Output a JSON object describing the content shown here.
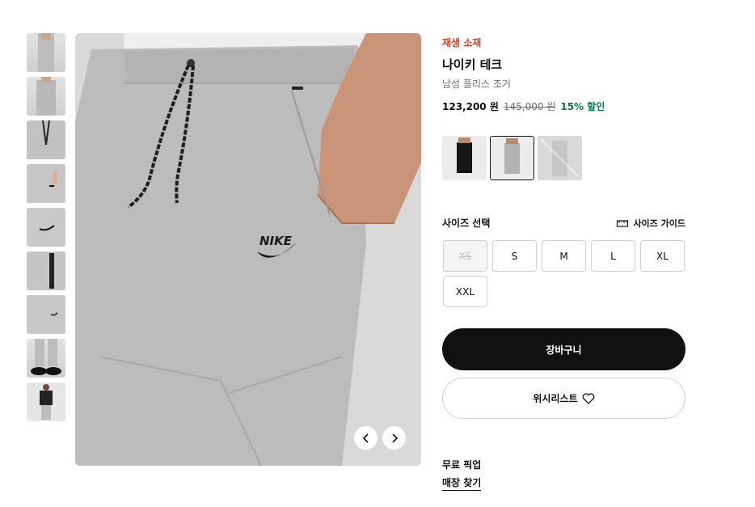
{
  "product": {
    "badge": "재생 소재",
    "title": "나이키 테크",
    "subtitle": "남성 플리스 조거",
    "price": "123,200 원",
    "original_price": "145,000 원",
    "discount": "15% 할인"
  },
  "gallery": {
    "thumbnail_count": 9,
    "prev_icon": "chevron-left-icon",
    "next_icon": "chevron-right-icon"
  },
  "colors": {
    "swatch_count": 3,
    "selected_index": 1
  },
  "size": {
    "title": "사이즈 선택",
    "guide_label": "사이즈 가이드",
    "guide_icon": "ruler-icon",
    "options": [
      "XS",
      "S",
      "M",
      "L",
      "XL",
      "XXL"
    ],
    "unavailable": [
      "XS"
    ]
  },
  "actions": {
    "cart_label": "장바구니",
    "wishlist_label": "위시리스트",
    "wishlist_icon": "heart-icon"
  },
  "pickup": {
    "title": "무료 픽업",
    "store_link": "매장 찾기"
  },
  "colors_palette": {
    "badge": "#d43f21",
    "discount": "#007d48",
    "primary": "#111111",
    "muted": "#707072"
  }
}
